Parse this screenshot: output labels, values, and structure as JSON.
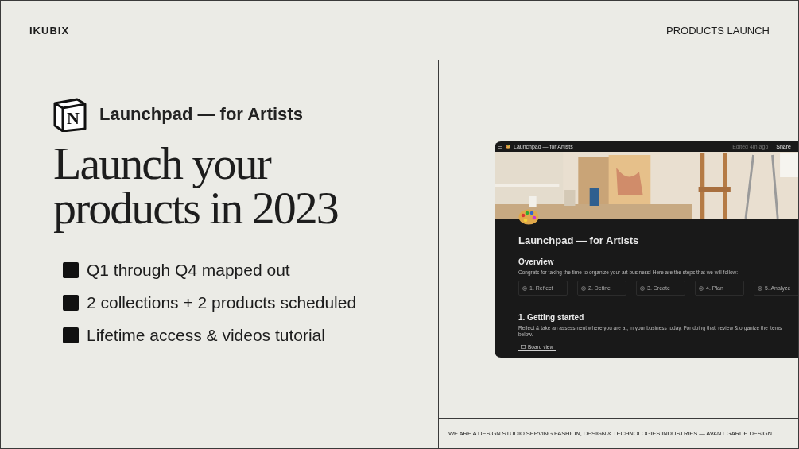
{
  "header": {
    "brand": "IKUBIX",
    "section": "PRODUCTS LAUNCH"
  },
  "hero": {
    "logo_letter": "N",
    "product": "Launchpad — for Artists",
    "headline": [
      "Launch your",
      "products in 2023"
    ],
    "features": [
      "Q1 through Q4 mapped out",
      "2 collections + 2 products scheduled",
      "Lifetime access & videos tutorial"
    ]
  },
  "preview": {
    "page_name": "Launchpad — for Artists",
    "edited": "Edited 4m ago",
    "share": "Share",
    "title": "Launchpad — for Artists",
    "overview_heading": "Overview",
    "overview_text": "Congrats for taking the time to organize your art business! Here are the steps that we will follow:",
    "steps": [
      "1. Reflect",
      "2. Define",
      "3. Create",
      "4. Plan",
      "5. Analyze"
    ],
    "section_heading": "1. Getting started",
    "section_text": "Reflect & take an assessment where you are at, in your business today. For doing that, review & organize the items below.",
    "view_tab": {
      "label": "Board view",
      "selected": true
    }
  },
  "footer": "WE ARE A DESIGN STUDIO SERVING FASHION, DESIGN & TECHNOLOGIES INDUSTRIES — AVANT GARDE DESIGN"
}
